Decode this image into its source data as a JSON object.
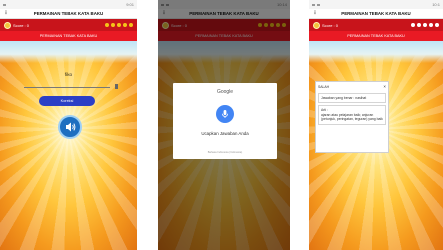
{
  "statusbar": {
    "time_1": "9:01",
    "time_2": "10:14",
    "time_3": "10:1"
  },
  "appbar": {
    "menu_icon": "vertical-dots-icon",
    "title": "PERMAINAN TEBAK KATA BAKU"
  },
  "scorebar": {
    "label": "Score :",
    "value": "0",
    "lives": 5,
    "colors": {
      "bar": "#c8141b",
      "lives": "#f5c319",
      "lives_alt": "#ffffff"
    }
  },
  "titlebar": {
    "text": "PERMAINAN TEBAK KATA BAKU"
  },
  "screen1": {
    "question_word": "fiko",
    "koreksi_label": "Koreksi",
    "speaker_icon": "speaker-icon"
  },
  "screen2": {
    "brand": "Google",
    "mic_icon": "microphone-icon",
    "prompt": "Ucapkan Jawaban Anda",
    "language": "Bahasa Indonesia (Indonesia)"
  },
  "screen3": {
    "heading": "SALAH",
    "close_icon": "close-icon",
    "answer_text": "Jawaban yang benar : nasihat",
    "meaning_label": "Arti :",
    "meaning_text": "ajaran atau pelajaran baik; anjuran (petunjuk, peringatan, teguran) yang baik"
  }
}
